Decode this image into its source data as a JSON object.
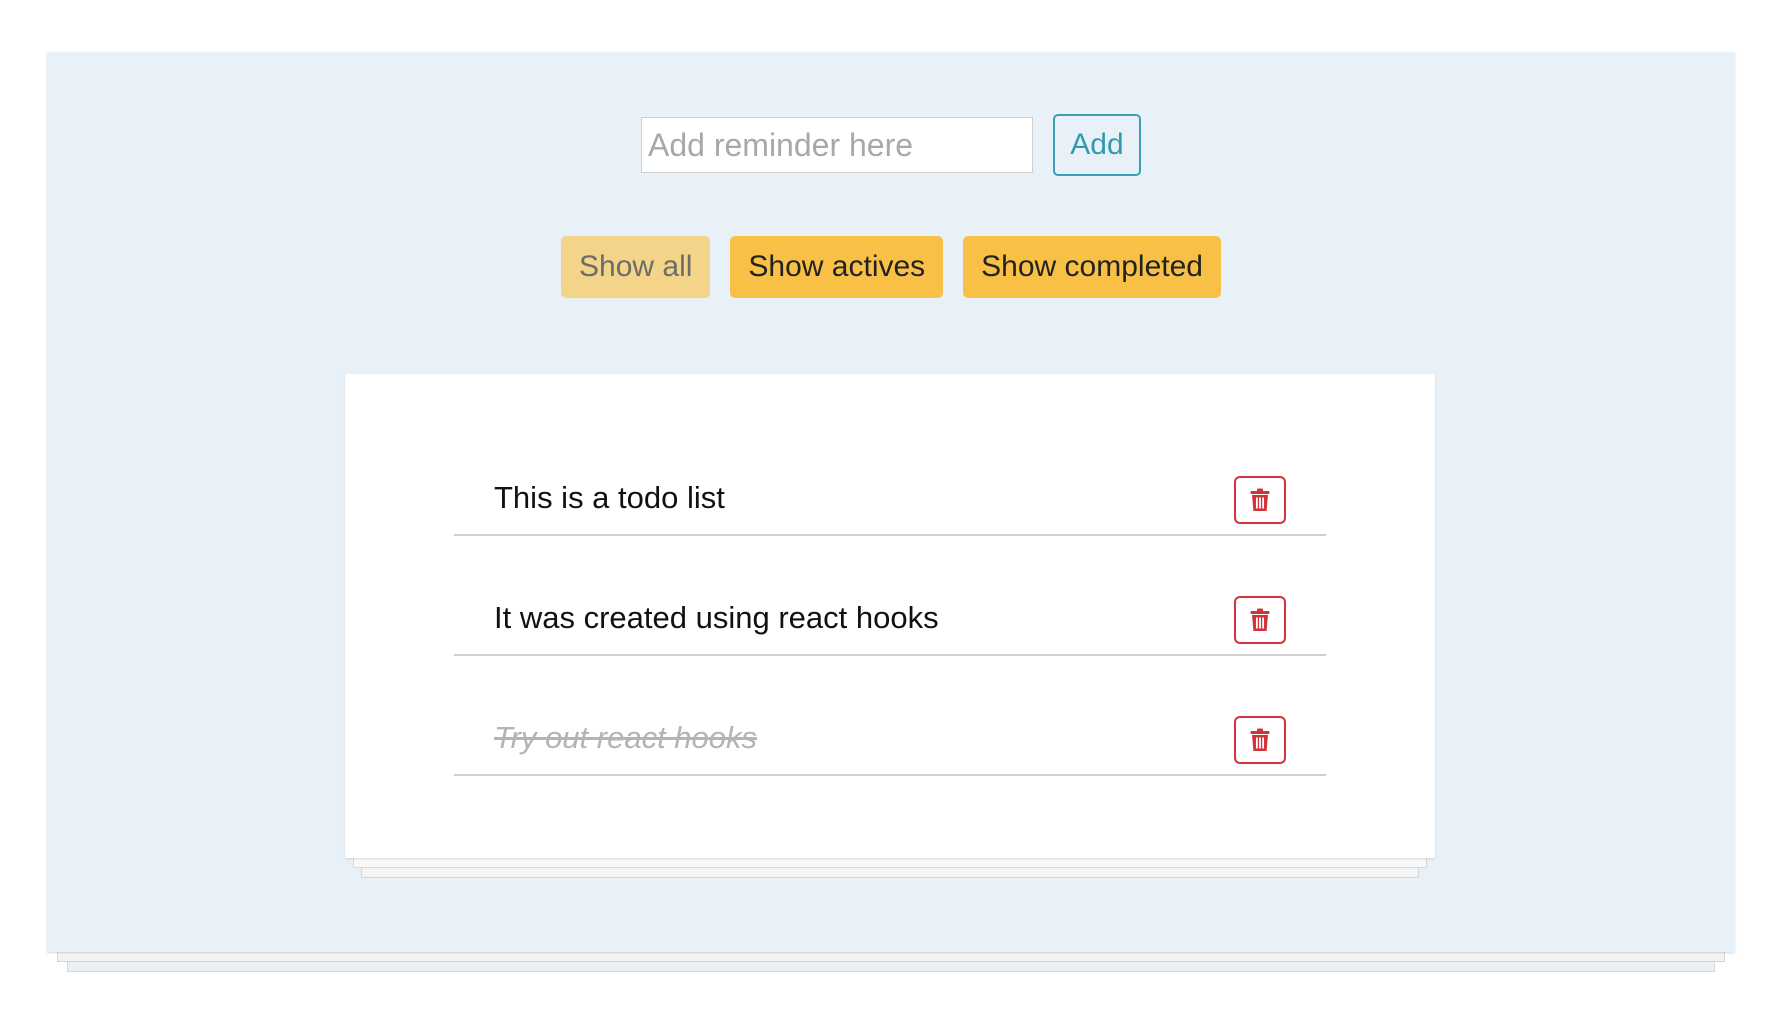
{
  "add_form": {
    "input_placeholder": "Add reminder here",
    "input_value": "",
    "add_label": "Add"
  },
  "filters": [
    {
      "label": "Show all",
      "selected": true
    },
    {
      "label": "Show actives",
      "selected": false
    },
    {
      "label": "Show completed",
      "selected": false
    }
  ],
  "todos": [
    {
      "text": "This is a todo list",
      "completed": false,
      "delete_icon": "trash-icon"
    },
    {
      "text": "It was created using react hooks",
      "completed": false,
      "delete_icon": "trash-icon"
    },
    {
      "text": "Try out react hooks",
      "completed": true,
      "delete_icon": "trash-icon"
    }
  ],
  "colors": {
    "panel_background": "#e8f1f7",
    "add_button_accent": "#2f9bb0",
    "filter_button": "#f8c145",
    "filter_button_selected": "#f3d489",
    "delete_accent": "#d1333c",
    "completed_text": "#b4b4b4"
  }
}
